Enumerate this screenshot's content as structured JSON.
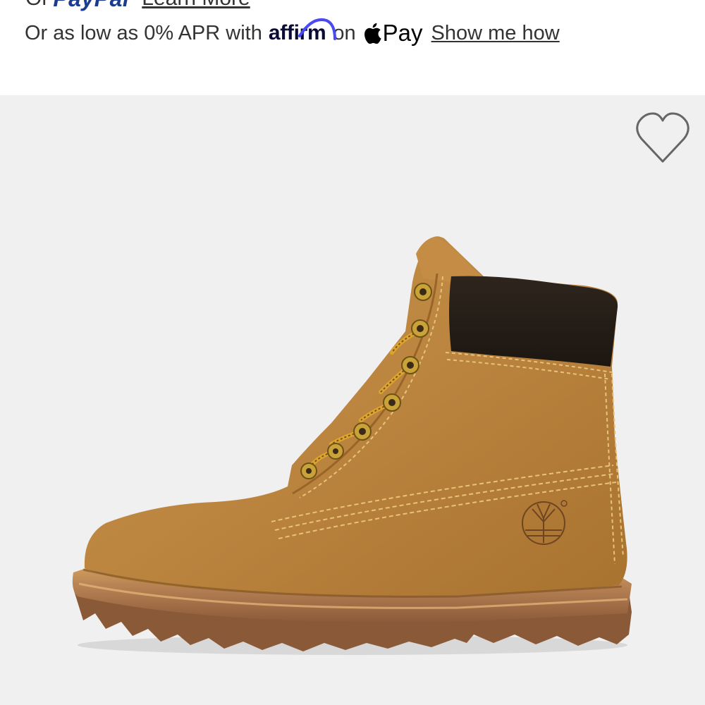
{
  "paypal": {
    "prefix": "Or",
    "logo_left": "P",
    "logo_right": "ayPal",
    "learn_more": "Learn More"
  },
  "affirm": {
    "lead_text": "Or as low as 0% APR with",
    "logo_text": "affirm",
    "on_text": "on",
    "apple_pay_text": "Pay",
    "show_me_how": "Show me how"
  },
  "product": {
    "image_alt": "Timberland 6-inch premium waterproof boot in wheat nubuck",
    "wishlist_icon": "heart-outline-icon"
  },
  "colors": {
    "affirm_arc": "#4a4af4",
    "paypal_blue": "#1b3b8f",
    "image_background": "#f0f0f0",
    "boot_wheat": "#c08a3e",
    "collar_black": "#241c15",
    "sole_brown": "#8a5a38"
  }
}
